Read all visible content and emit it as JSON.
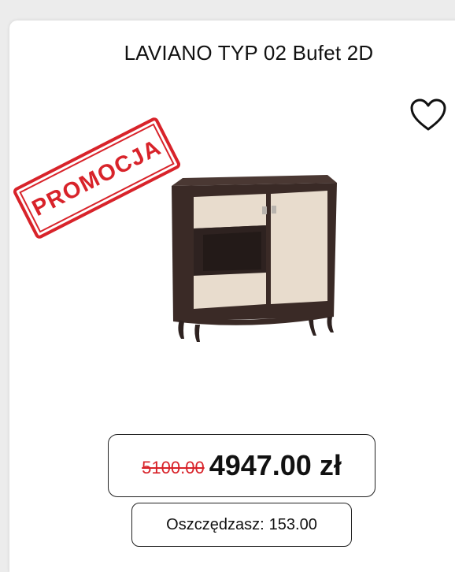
{
  "product": {
    "title": "LAVIANO TYP 02 Bufet 2D",
    "promo_stamp": "PROMOCJA",
    "image_icon": "sideboard-image",
    "favorite_icon": "heart-outline-icon"
  },
  "pricing": {
    "old_price": "5100.00",
    "new_price": "4947.00 zł",
    "savings_label": "Oszczędzasz:",
    "savings_value": "153.00"
  },
  "colors": {
    "promo_red": "#d8232a",
    "cabinet_dark": "#3a2a26",
    "door_cream": "#e8dccd"
  }
}
